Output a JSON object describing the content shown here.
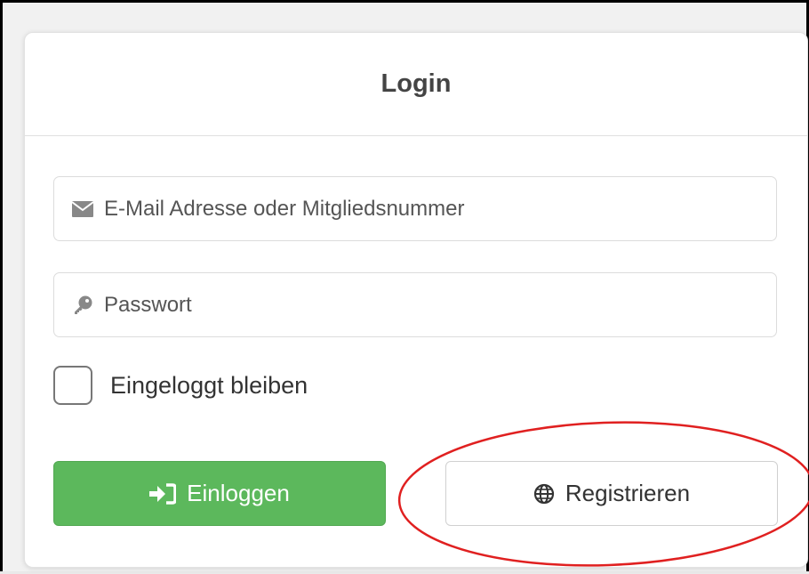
{
  "card": {
    "title": "Login"
  },
  "form": {
    "email_placeholder": "E-Mail Adresse oder Mitgliedsnummer",
    "password_placeholder": "Passwort",
    "remember_label": "Eingeloggt bleiben",
    "remember_checked": false
  },
  "buttons": {
    "login_label": "Einloggen",
    "register_label": "Registrieren"
  },
  "icons": {
    "email": "envelope-icon",
    "password": "key-icon",
    "login": "sign-in-icon",
    "register": "globe-icon"
  },
  "colors": {
    "login_button": "#5cb85c",
    "annotation_circle": "#e02020"
  }
}
